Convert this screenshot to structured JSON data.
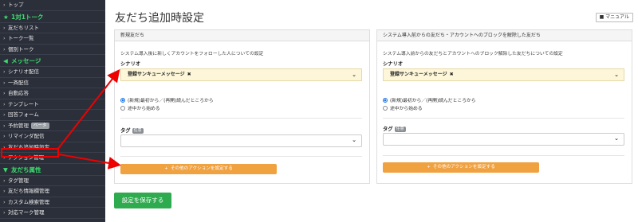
{
  "sidebar": {
    "items": [
      {
        "type": "item",
        "label": "トップ"
      },
      {
        "type": "section",
        "label": "1対1トーク",
        "icon": "star-icon"
      },
      {
        "type": "item",
        "label": "友だちリスト"
      },
      {
        "type": "item",
        "label": "トーク一覧"
      },
      {
        "type": "item",
        "label": "個別トーク"
      },
      {
        "type": "section",
        "label": "メッセージ",
        "icon": "megaphone-icon"
      },
      {
        "type": "item",
        "label": "シナリオ配信"
      },
      {
        "type": "item",
        "label": "一斉配信"
      },
      {
        "type": "item",
        "label": "自動応答"
      },
      {
        "type": "item",
        "label": "テンプレート"
      },
      {
        "type": "item",
        "label": "回答フォーム"
      },
      {
        "type": "item",
        "label": "予約管理",
        "badge": "ベータ"
      },
      {
        "type": "item",
        "label": "リマインダ配信"
      },
      {
        "type": "item",
        "label": "友だち追加時設定",
        "active": true
      },
      {
        "type": "item",
        "label": "アクション管理"
      },
      {
        "type": "section",
        "label": "友だち属性",
        "icon": "filter-icon"
      },
      {
        "type": "item",
        "label": "タグ管理"
      },
      {
        "type": "item",
        "label": "友だち情報欄管理"
      },
      {
        "type": "item",
        "label": "カスタム検索管理"
      },
      {
        "type": "item",
        "label": "対応マーク管理"
      }
    ]
  },
  "header": {
    "title": "友だち追加時設定",
    "manual_label": "マニュアル"
  },
  "panels": {
    "left": {
      "heading": "新規友だち",
      "description": "システム導入後に新しくアカウントをフォローした人についての設定",
      "scenario_label": "シナリオ",
      "scenario_value": "登録サンキューメッセージ",
      "radio_start": "(新規)最初から／(再開)読んだところから",
      "radio_middle": "途中から始める",
      "tag_label": "タグ",
      "tag_badge": "任意",
      "action_label": "その他のアクションを設定する"
    },
    "right": {
      "heading": "システム導入前からの友だち・アカウントへのブロックを解除した友だち",
      "description": "システム導入前からの友だちとアカウントへのブロック解除した友だちについての設定",
      "scenario_label": "シナリオ",
      "scenario_value": "登録サンキューメッセージ",
      "radio_start": "(新規)最初から／(再開)読んだところから",
      "radio_middle": "途中から始める",
      "tag_label": "タグ",
      "tag_badge": "任意",
      "action_label": "その他のアクションを設定する"
    }
  },
  "save_label": "設定を保存する",
  "colors": {
    "sidebar_bg": "#2b2f3a",
    "section_green": "#3ddc6e",
    "scenario_bg": "#fdf6d9",
    "action_orange": "#f0a140",
    "save_green": "#2eaa4f",
    "annotation_red": "#e00000"
  }
}
